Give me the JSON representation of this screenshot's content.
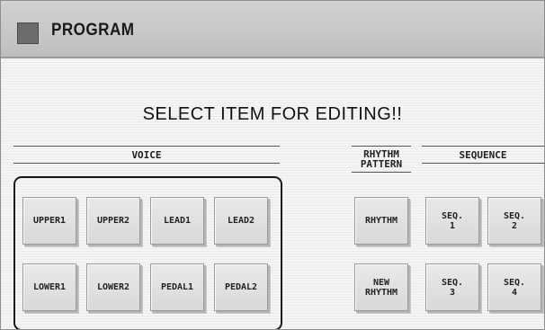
{
  "header": {
    "title": "PROGRAM",
    "icon": "program-square-icon"
  },
  "instruction": "SELECT ITEM FOR EDITING!!",
  "sections": {
    "voice": {
      "label": "VOICE",
      "buttons": [
        "UPPER1",
        "UPPER2",
        "LEAD1",
        "LEAD2",
        "LOWER1",
        "LOWER2",
        "PEDAL1",
        "PEDAL2"
      ]
    },
    "rhythm_pattern": {
      "label": "RHYTHM\nPATTERN",
      "buttons": [
        "RHYTHM",
        "NEW\nRHYTHM"
      ]
    },
    "sequence": {
      "label": "SEQUENCE",
      "buttons": [
        "SEQ.\n1",
        "SEQ.\n2",
        "SEQ.\n3",
        "SEQ.\n4"
      ]
    }
  },
  "colors": {
    "background": "#f5f5f5",
    "titlebar": "#c9c9c9",
    "button": "#e1e1e1",
    "text": "#111111"
  }
}
